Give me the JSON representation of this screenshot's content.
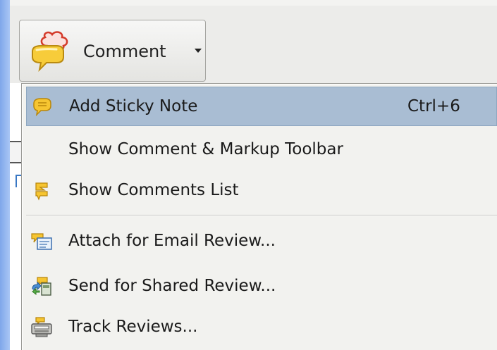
{
  "toolbar": {
    "comment_button_label": "Comment"
  },
  "menu": {
    "items": [
      {
        "label": "Add Sticky Note",
        "shortcut": "Ctrl+6",
        "icon": "sticky-note-icon",
        "highlighted": true
      },
      {
        "label": "Show Comment & Markup Toolbar",
        "shortcut": "",
        "icon": ""
      },
      {
        "label": "Show Comments List",
        "shortcut": "",
        "icon": "comments-list-icon"
      },
      {
        "label": "Attach for Email Review...",
        "shortcut": "",
        "icon": "email-review-icon"
      },
      {
        "label": "Send for Shared Review...",
        "shortcut": "",
        "icon": "shared-review-icon"
      },
      {
        "label": "Track Reviews...",
        "shortcut": "",
        "icon": "track-reviews-icon"
      }
    ]
  },
  "colors": {
    "highlight": "#a9bdd3",
    "menu_bg": "#f2f2ef",
    "frame_blue": "#7fa7ea"
  }
}
